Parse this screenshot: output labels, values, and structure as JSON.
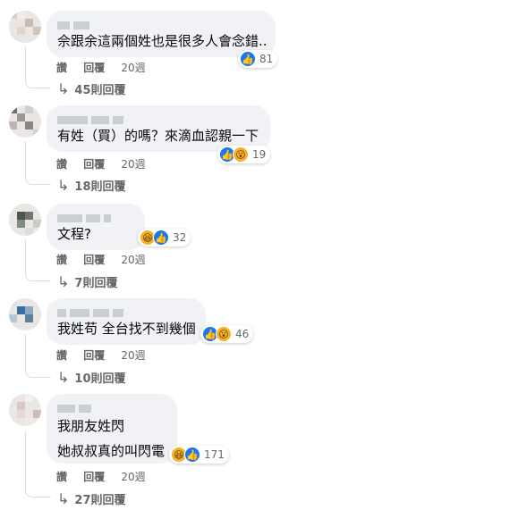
{
  "comments": [
    {
      "text": [
        "佘跟余這兩個姓也是很多人會念錯.."
      ],
      "reactions": [
        "like"
      ],
      "count": "81",
      "actions": {
        "like": "讚",
        "reply": "回覆",
        "time": "20週"
      },
      "replies": "45則回覆"
    },
    {
      "text": [
        "有姓（買）的嗎？來滴血認親一下"
      ],
      "reactions": [
        "like",
        "wow"
      ],
      "count": "19",
      "actions": {
        "like": "讚",
        "reply": "回覆",
        "time": "20週"
      },
      "replies": "18則回覆"
    },
    {
      "text": [
        "文程?"
      ],
      "reactions": [
        "haha",
        "like"
      ],
      "count": "32",
      "actions": {
        "like": "讚",
        "reply": "回覆",
        "time": "20週"
      },
      "replies": "7則回覆"
    },
    {
      "text": [
        "我姓苟 全台找不到幾個"
      ],
      "reactions": [
        "like",
        "wow"
      ],
      "count": "46",
      "actions": {
        "like": "讚",
        "reply": "回覆",
        "time": "20週"
      },
      "replies": "10則回覆"
    },
    {
      "text": [
        "我朋友姓閃",
        "她叔叔真的叫閃電"
      ],
      "reactions": [
        "haha",
        "like"
      ],
      "count": "171",
      "actions": {
        "like": "讚",
        "reply": "回覆",
        "time": "20週"
      },
      "replies": "27則回覆"
    }
  ],
  "icons": {
    "like": "thumbs-up-icon",
    "haha": "laughing-face-icon",
    "wow": "surprised-face-icon",
    "reply_arrow": "reply-arrow-icon"
  },
  "colors": {
    "bubble": "#f0f2f5",
    "like_blue": "#1877f2",
    "emoji_yellow": "#f7b125",
    "meta_gray": "#65676b"
  }
}
